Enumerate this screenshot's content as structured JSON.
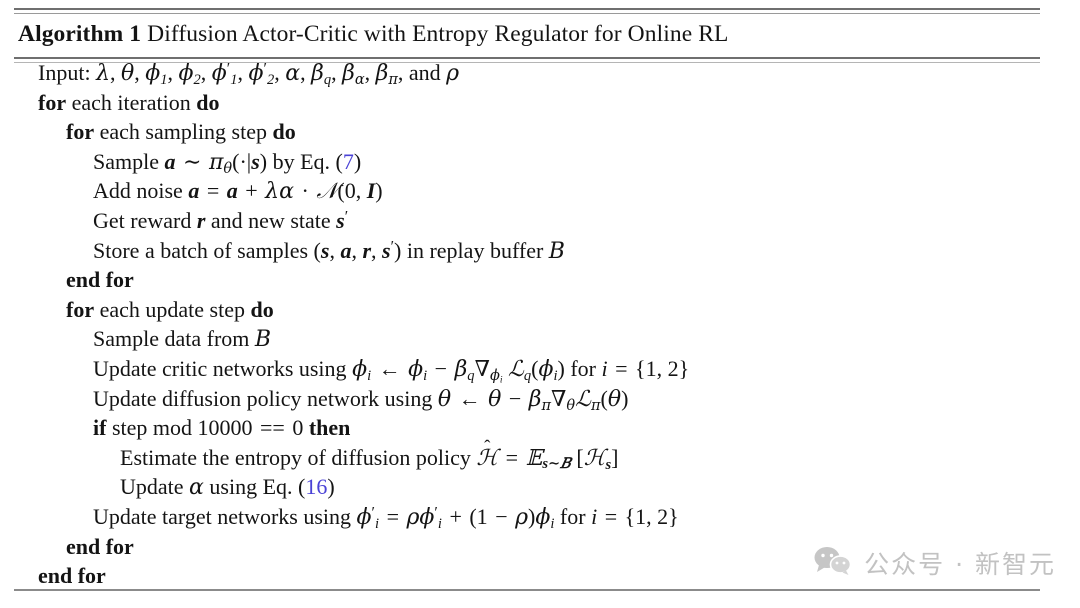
{
  "algorithm": {
    "label": "Algorithm 1",
    "title": "Diffusion Actor-Critic with Entropy Regulator for Online RL",
    "link_color": "#4a42d6",
    "rule_color": "#6f6f6f",
    "lines": [
      {
        "indent": 0,
        "text": "Input: λ, θ, ϕ₁, ϕ₂, ϕ′₁, ϕ′₂, α, β_q, β_α, β_π, and ρ"
      },
      {
        "indent": 0,
        "text": "for each iteration do"
      },
      {
        "indent": 1,
        "text": "for each sampling step do"
      },
      {
        "indent": 2,
        "text": "Sample a ~ π_θ(·|s) by Eq. (7)"
      },
      {
        "indent": 2,
        "text": "Add noise a = a + λα · N(0, I)"
      },
      {
        "indent": 2,
        "text": "Get reward r and new state s′"
      },
      {
        "indent": 2,
        "text": "Store a batch of samples (s, a, r, s′) in replay buffer B"
      },
      {
        "indent": 1,
        "text": "end for"
      },
      {
        "indent": 1,
        "text": "for each update step do"
      },
      {
        "indent": 2,
        "text": "Sample data from B"
      },
      {
        "indent": 2,
        "text": "Update critic networks using ϕ_i ← ϕ_i − β_q ∇_{ϕ_i} L_q(ϕ_i) for i = {1, 2}"
      },
      {
        "indent": 2,
        "text": "Update diffusion policy network using θ ← θ − β_π ∇_θ L_π(θ)"
      },
      {
        "indent": 2,
        "text": "if step mod 10000 == 0 then"
      },
      {
        "indent": 3,
        "text": "Estimate the entropy of diffusion policy Ĥ = E_{s~B} [H_s]"
      },
      {
        "indent": 3,
        "text": "Update α using Eq. (16)"
      },
      {
        "indent": 2,
        "text": "Update target networks using ϕ′_i = ρϕ′_i + (1 − ρ)ϕ_i for i = {1, 2}"
      },
      {
        "indent": 1,
        "text": "end for"
      },
      {
        "indent": 0,
        "text": "end for"
      }
    ],
    "equation_refs": [
      "7",
      "16"
    ],
    "mod_period": "10000",
    "index_set": "{1, 2}"
  },
  "watermark": {
    "icon": "wechat-bubbles-icon",
    "text": "公众号 · 新智元",
    "color": "#c2c2c2"
  }
}
